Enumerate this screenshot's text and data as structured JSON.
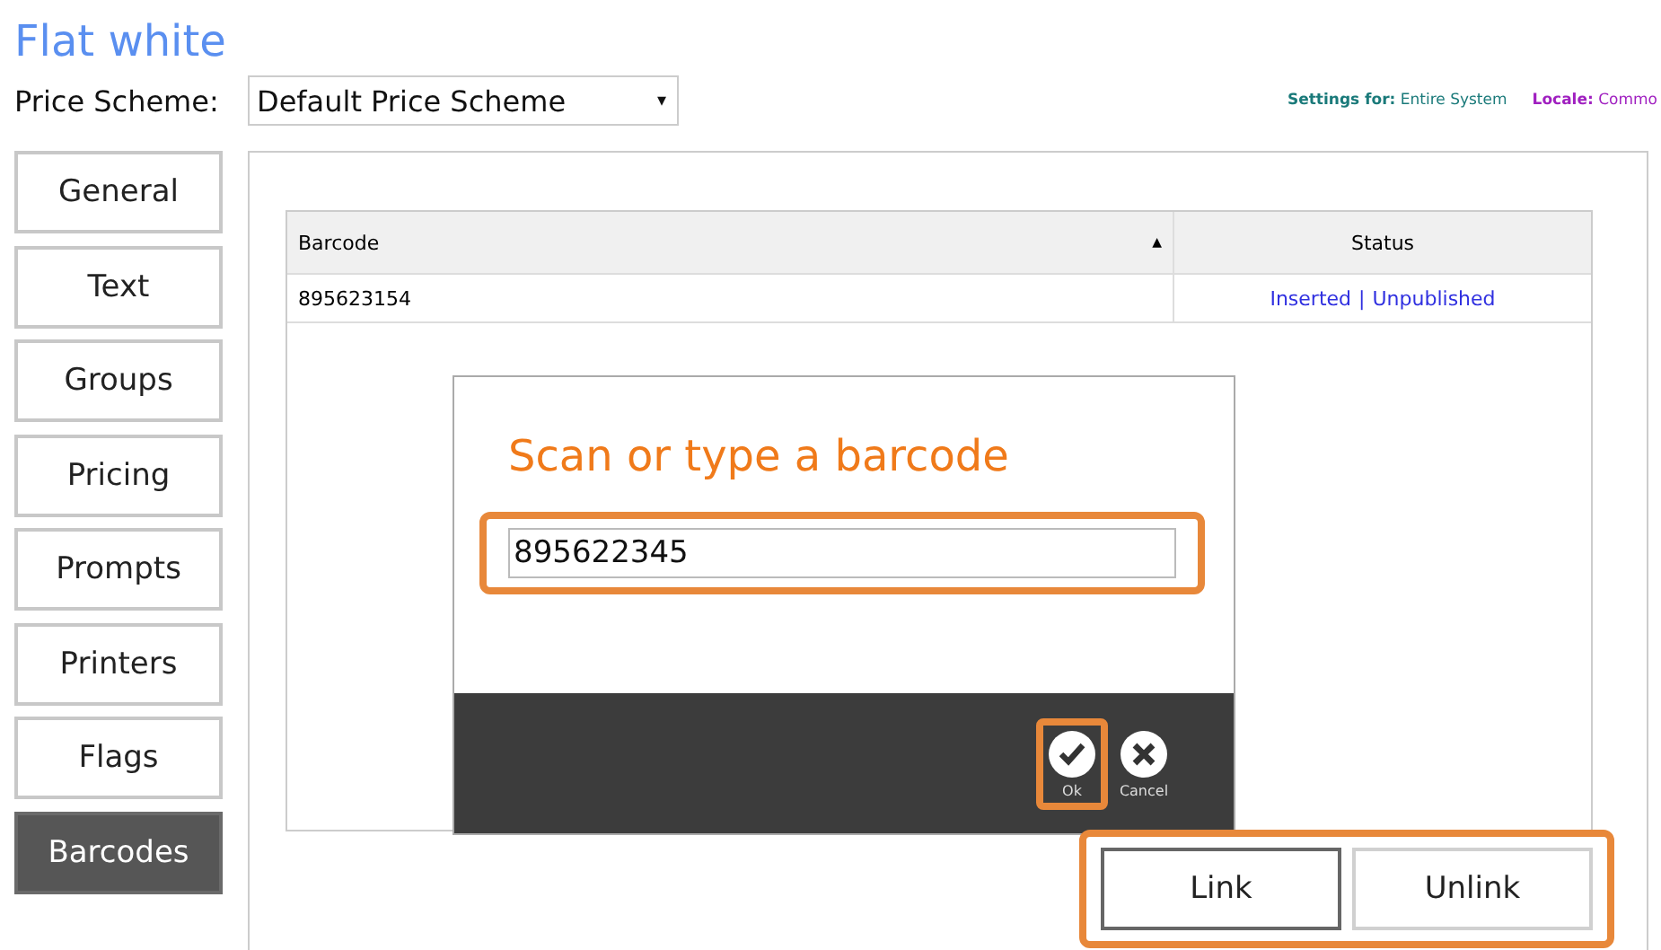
{
  "title": "Flat white",
  "price_scheme": {
    "label": "Price Scheme:",
    "value": "Default Price Scheme",
    "caret": "▾"
  },
  "settings_for": {
    "label": "Settings for:",
    "value": "Entire System"
  },
  "locale": {
    "label": "Locale:",
    "value": "Commo"
  },
  "sidebar": {
    "items": [
      {
        "label": "General",
        "selected": false
      },
      {
        "label": "Text",
        "selected": false
      },
      {
        "label": "Groups",
        "selected": false
      },
      {
        "label": "Pricing",
        "selected": false
      },
      {
        "label": "Prompts",
        "selected": false
      },
      {
        "label": "Printers",
        "selected": false
      },
      {
        "label": "Flags",
        "selected": false
      },
      {
        "label": "Barcodes",
        "selected": true
      }
    ]
  },
  "table": {
    "columns": [
      {
        "label": "Barcode",
        "sort": "▲"
      },
      {
        "label": "Status"
      }
    ],
    "rows": [
      {
        "barcode": "895623154",
        "status": [
          "Inserted",
          "|",
          "Unpublished"
        ]
      }
    ]
  },
  "dialog": {
    "title": "Scan or type a barcode",
    "value": "895622345",
    "buttons": [
      {
        "kind": "ok",
        "label": "Ok",
        "highlighted": true
      },
      {
        "kind": "cancel",
        "label": "Cancel",
        "highlighted": false
      }
    ]
  },
  "actions": [
    {
      "label": "Link"
    },
    {
      "label": "Unlink"
    }
  ]
}
